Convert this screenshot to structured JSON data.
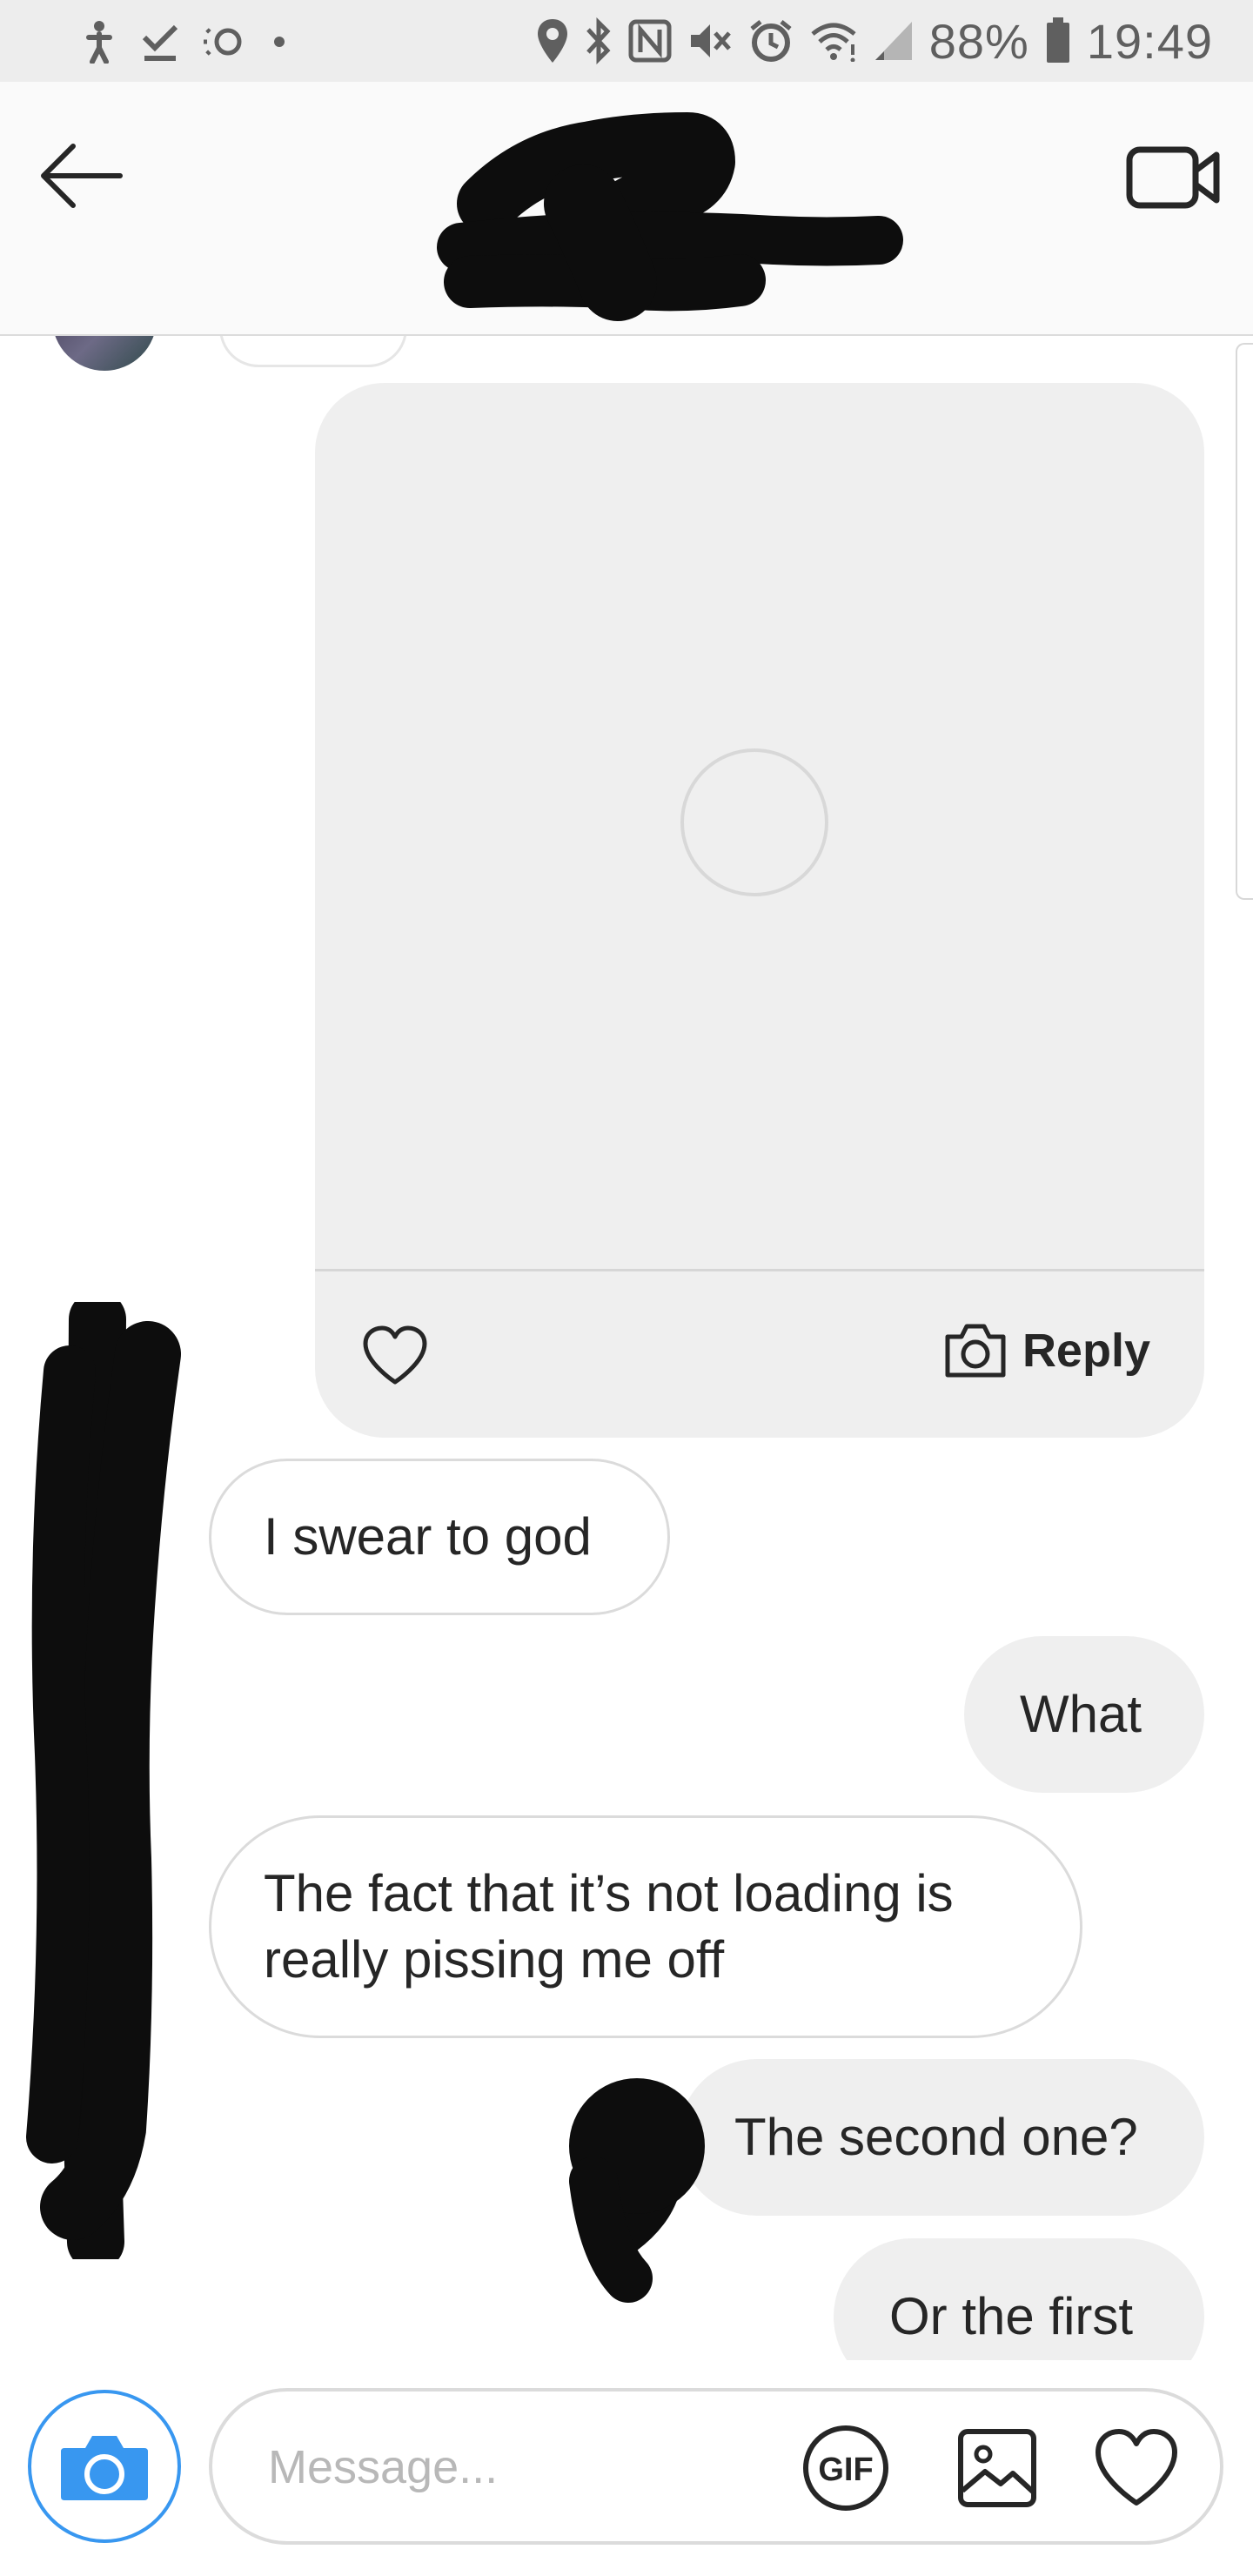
{
  "status_bar": {
    "battery": "88%",
    "time": "19:49",
    "left_icons": [
      "accessibility-icon",
      "download-done-icon",
      "cloud-sync-icon",
      "dot-icon"
    ],
    "right_icons": [
      "location-icon",
      "bluetooth-icon",
      "nfc-icon",
      "mute-icon",
      "alarm-icon",
      "wifi-icon",
      "signal-icon",
      "battery-icon"
    ]
  },
  "header": {
    "back_icon": "arrow-left-icon",
    "video_call_icon": "video-camera-icon"
  },
  "media_message": {
    "like_icon": "heart-outline-icon",
    "reply_icon": "camera-icon",
    "reply_label": "Reply"
  },
  "messages": [
    {
      "direction": "incoming",
      "text": "I swear to god"
    },
    {
      "direction": "outgoing",
      "text": "What"
    },
    {
      "direction": "incoming",
      "text": "The fact that it’s not loading is really pissing me off"
    },
    {
      "direction": "outgoing",
      "text": "The second one?"
    },
    {
      "direction": "outgoing",
      "text": "Or the first"
    }
  ],
  "composer": {
    "placeholder": "Message...",
    "gif_label": "GIF",
    "camera_icon": "camera-icon",
    "gallery_icon": "image-icon",
    "like_icon": "heart-outline-icon"
  },
  "colors": {
    "accent": "#3897f0",
    "outgoing_bubble": "#efefef",
    "incoming_border": "#dbdbdb",
    "header_bg": "#fafafa",
    "status_bg": "#ededed",
    "redaction": "#0d0d0d"
  }
}
